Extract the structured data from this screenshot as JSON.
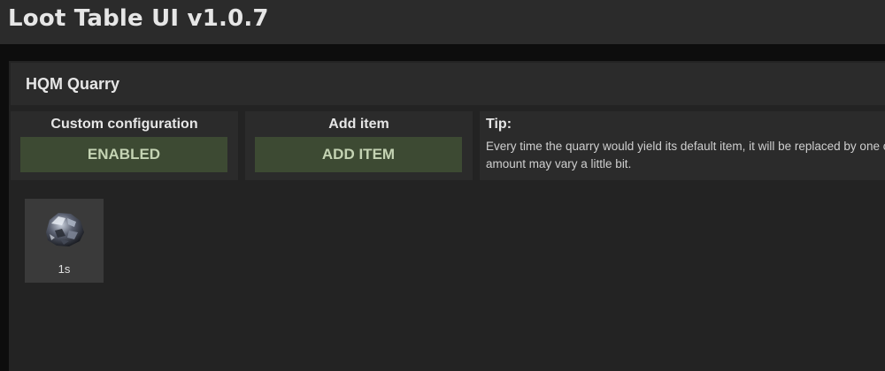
{
  "window": {
    "title": "Loot Table UI v1.0.7"
  },
  "header": {
    "title": "HQM Quarry"
  },
  "config": {
    "label": "Custom configuration",
    "button": "ENABLED"
  },
  "add_item": {
    "label": "Add item",
    "button": "ADD ITEM"
  },
  "tip": {
    "title": "Tip:",
    "text": "Every time the quarry would yield its default item, it will be replaced by one of the items below. The amount may vary a little bit."
  },
  "items": [
    {
      "icon": "hqm-ore-icon",
      "quantity": "1s"
    }
  ],
  "colors": {
    "background": "#0d0d0d",
    "panel": "#232323",
    "bar": "#2b2b2b",
    "button_green": "#3d4a33",
    "button_text": "#c4d3b3",
    "item_card": "#3a3a3a"
  }
}
